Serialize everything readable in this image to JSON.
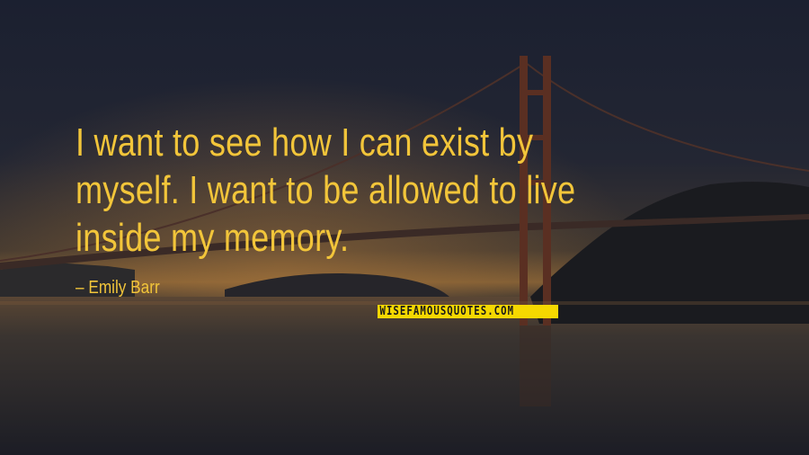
{
  "quote": {
    "text": "I want to see how I can exist by myself. I want to be allowed to live inside my memory.",
    "author": "Emily Barr"
  },
  "watermark": {
    "text": "WISEFAMOUSQUOTES.COM"
  },
  "colors": {
    "quote_text": "#f2c53a",
    "watermark_bg": "#f5d800",
    "sky_top": "#1a1f2e",
    "horizon_glow": "#8a5a2e"
  },
  "icons": {
    "author_bullet": "dash"
  }
}
